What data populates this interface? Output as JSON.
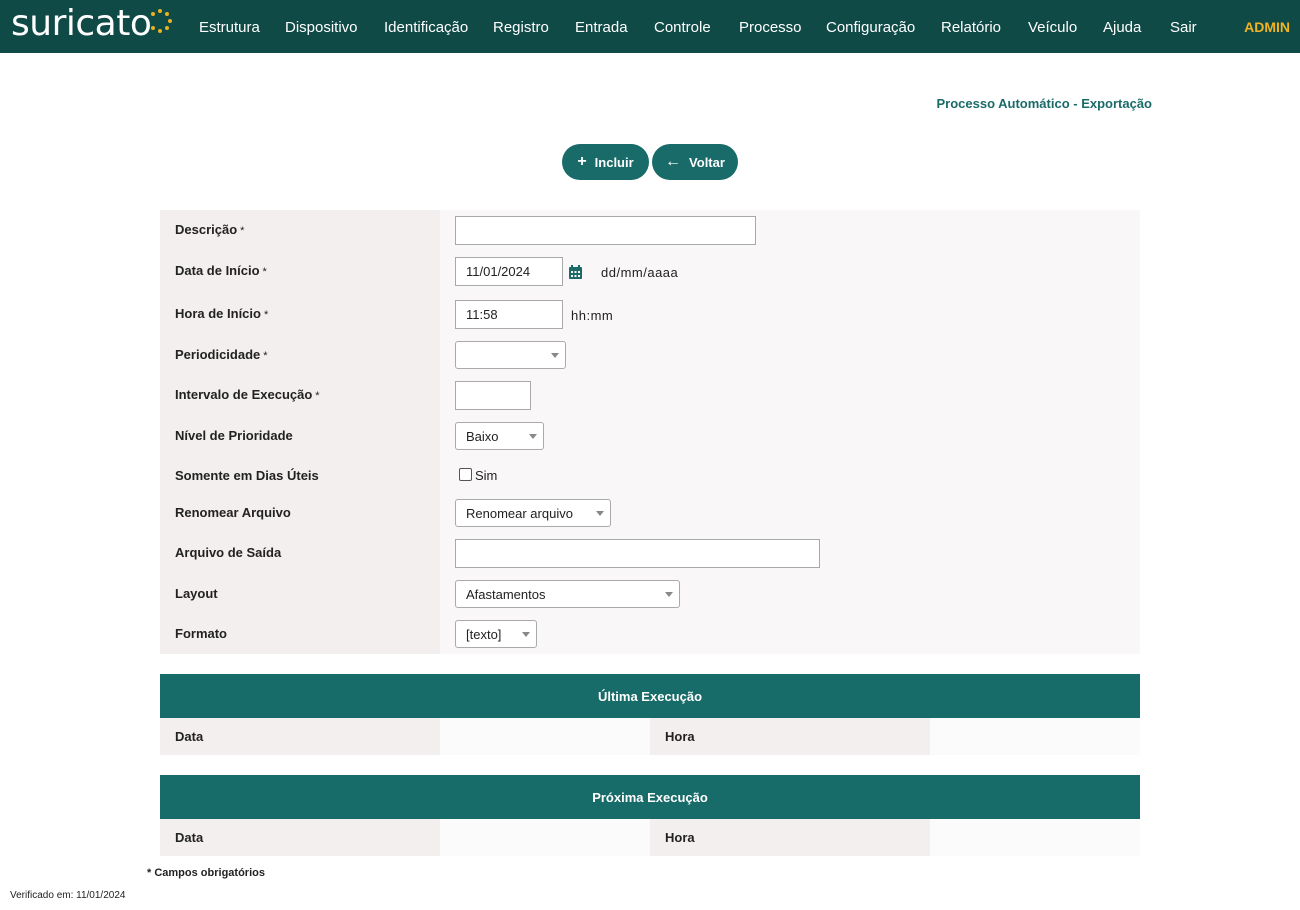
{
  "app": {
    "logo_text": "suricato",
    "user": "ADMIN",
    "brand_color": "#0f4a47",
    "accent_color": "#f0b323"
  },
  "nav": [
    {
      "label": "Estrutura"
    },
    {
      "label": "Dispositivo"
    },
    {
      "label": "Identificação"
    },
    {
      "label": "Registro"
    },
    {
      "label": "Entrada"
    },
    {
      "label": "Controle"
    },
    {
      "label": "Processo"
    },
    {
      "label": "Configuração"
    },
    {
      "label": "Relatório"
    },
    {
      "label": "Veículo"
    },
    {
      "label": "Ajuda"
    },
    {
      "label": "Sair"
    }
  ],
  "page": {
    "title": "Processo Automático - Exportação"
  },
  "actions": {
    "include_label": "Incluir",
    "include_icon": "plus-icon",
    "back_label": "Voltar",
    "back_icon": "arrow-left-icon"
  },
  "form": {
    "required_mark": "*",
    "descricao": {
      "label": "Descrição",
      "value": ""
    },
    "data_inicio": {
      "label": "Data de Início",
      "value": "11/01/2024",
      "hint": "dd/mm/aaaa"
    },
    "hora_inicio": {
      "label": "Hora de Início",
      "value": "11:58",
      "hint": "hh:mm"
    },
    "periodicidade": {
      "label": "Periodicidade",
      "value": ""
    },
    "intervalo": {
      "label": "Intervalo de Execução",
      "value": ""
    },
    "prioridade": {
      "label": "Nível de Prioridade",
      "value": "Baixo"
    },
    "dias_uteis": {
      "label": "Somente em Dias Úteis",
      "checkbox_label": "Sim",
      "checked": false
    },
    "renomear": {
      "label": "Renomear Arquivo",
      "value": "Renomear arquivo"
    },
    "arquivo_saida": {
      "label": "Arquivo de Saída",
      "value": ""
    },
    "layout": {
      "label": "Layout",
      "value": "Afastamentos"
    },
    "formato": {
      "label": "Formato",
      "value": "[texto]"
    }
  },
  "ultima_execucao": {
    "title": "Última Execução",
    "data_label": "Data",
    "data_value": "",
    "hora_label": "Hora",
    "hora_value": ""
  },
  "proxima_execucao": {
    "title": "Próxima Execução",
    "data_label": "Data",
    "data_value": "",
    "hora_label": "Hora",
    "hora_value": ""
  },
  "footer": {
    "required_note": "* Campos obrigatórios",
    "verified": "Verificado em: 11/01/2024"
  }
}
